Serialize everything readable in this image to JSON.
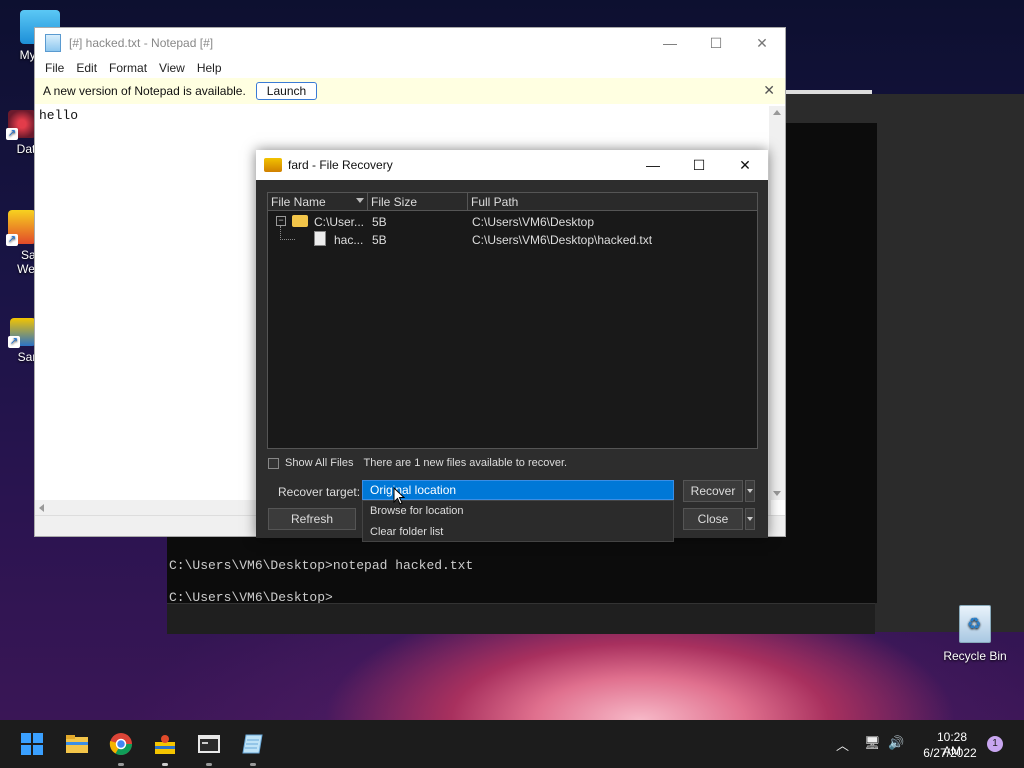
{
  "desktop": {
    "icons": [
      {
        "label": "My Co"
      },
      {
        "label": "DataW"
      },
      {
        "label": "Sand"
      },
      {
        "label": "Web B"
      },
      {
        "label": "Sandb"
      }
    ],
    "recycle_bin": "Recycle Bin"
  },
  "terminal": {
    "lines": [
      "C:\\Users\\VM6\\Desktop>notepad hacked.txt",
      "C:\\Users\\VM6\\Desktop>"
    ]
  },
  "notepad": {
    "title": "[#] hacked.txt - Notepad [#]",
    "menu": [
      "File",
      "Edit",
      "Format",
      "View",
      "Help"
    ],
    "banner_text": "A new version of Notepad is available.",
    "banner_button": "Launch",
    "content": "hello"
  },
  "recovery": {
    "title": "fard - File Recovery",
    "columns": [
      "File Name",
      "File Size",
      "Full Path"
    ],
    "rows": [
      {
        "name": "C:\\User...",
        "size": "5B",
        "path": "C:\\Users\\VM6\\Desktop"
      },
      {
        "name": "hac...",
        "size": "5B",
        "path": "C:\\Users\\VM6\\Desktop\\hacked.txt"
      }
    ],
    "show_all_label": "Show All Files",
    "status": "There are 1 new files available to recover.",
    "target_label": "Recover target:",
    "target_selected": "Original location",
    "target_options": [
      "Browse for location",
      "Clear folder list"
    ],
    "recover_button": "Recover",
    "refresh_button": "Refresh",
    "close_button": "Close"
  },
  "taskbar": {
    "time": "10:28 AM",
    "date": "6/27/2022",
    "notifications": "1"
  },
  "colors": {
    "accent": "#0078d7",
    "notepad_banner": "#ffffe1",
    "terminal_bg": "#0c0c0c"
  }
}
